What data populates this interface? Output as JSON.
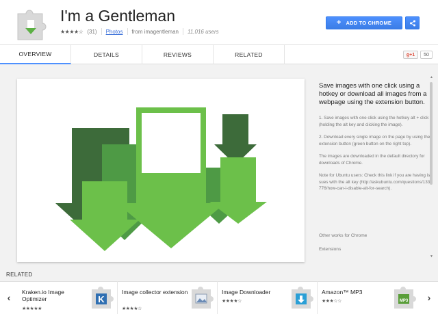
{
  "header": {
    "title": "I'm a Gentleman",
    "stars": "★★★★☆",
    "rating_count": "(31)",
    "photos_link": "Photos",
    "author": "from imagentleman",
    "users": "11,016 users",
    "add_button": "ADD TO CHROME",
    "add_icon": "+",
    "share_icon": "share-icon"
  },
  "tabs": [
    {
      "label": "OVERVIEW",
      "active": true
    },
    {
      "label": "DETAILS",
      "active": false
    },
    {
      "label": "REVIEWS",
      "active": false
    },
    {
      "label": "RELATED",
      "active": false
    }
  ],
  "gplus": {
    "label": "g+1",
    "count": "50"
  },
  "description": {
    "heading": "Save images with one click using a hotkey or download all images from a webpage using the extension button.",
    "p1": "1. Save images with one click using the hotkey alt + click (holding the alt key and clicking the image).",
    "p2": "2. Download every single image on the page by using the extension button (green button on the right top).",
    "p3": "The images are downloaded in the default directory for downloads of Chrome.",
    "p4": "Note for Ubuntu users: Check this link if you are having issues with the alt key (http://askubuntu.com/questions/133776/how-can-i-disable-alt-for-search).",
    "other_works": "Other works for Chrome",
    "extensions": "Extensions"
  },
  "colors": {
    "accent": "#4d90fe",
    "dark_green": "#3d6b3a",
    "mid_green": "#4e9a45",
    "light_green": "#6cc04a"
  },
  "related": {
    "label": "RELATED",
    "prev": "‹",
    "next": "›",
    "items": [
      {
        "name": "Kraken.io Image Optimizer",
        "stars": "★★★★★",
        "icon": "kraken-icon"
      },
      {
        "name": "Image collector extension",
        "stars": "★★★★☆",
        "icon": "image-collector-icon"
      },
      {
        "name": "Image Downloader",
        "stars": "★★★★☆",
        "icon": "image-downloader-icon"
      },
      {
        "name": "Amazon™ MP3",
        "stars": "★★★☆☆",
        "icon": "amazon-mp3-icon"
      }
    ]
  }
}
